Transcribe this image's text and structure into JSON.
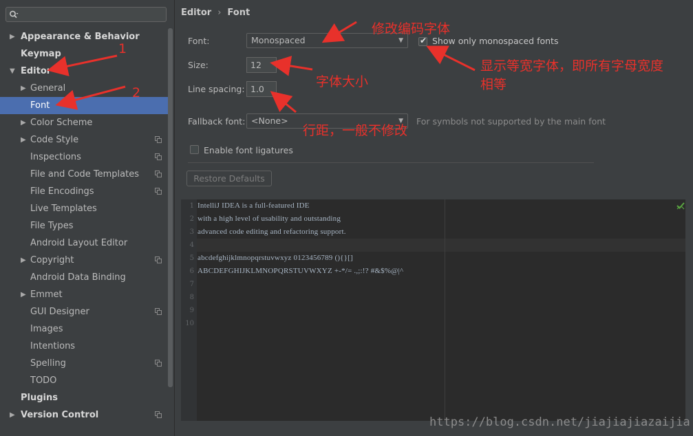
{
  "search": {
    "placeholder": ""
  },
  "sidebar": {
    "items": [
      {
        "label": "Appearance & Behavior",
        "level": 0,
        "expandable": true,
        "expanded": false,
        "bold": true,
        "project": false,
        "selected": false
      },
      {
        "label": "Keymap",
        "level": 0,
        "expandable": false,
        "expanded": false,
        "bold": true,
        "project": false,
        "selected": false
      },
      {
        "label": "Editor",
        "level": 0,
        "expandable": true,
        "expanded": true,
        "bold": true,
        "project": false,
        "selected": false
      },
      {
        "label": "General",
        "level": 1,
        "expandable": true,
        "expanded": false,
        "bold": false,
        "project": false,
        "selected": false
      },
      {
        "label": "Font",
        "level": 1,
        "expandable": false,
        "expanded": false,
        "bold": false,
        "project": false,
        "selected": true
      },
      {
        "label": "Color Scheme",
        "level": 1,
        "expandable": true,
        "expanded": false,
        "bold": false,
        "project": false,
        "selected": false
      },
      {
        "label": "Code Style",
        "level": 1,
        "expandable": true,
        "expanded": false,
        "bold": false,
        "project": true,
        "selected": false
      },
      {
        "label": "Inspections",
        "level": 1,
        "expandable": false,
        "expanded": false,
        "bold": false,
        "project": true,
        "selected": false
      },
      {
        "label": "File and Code Templates",
        "level": 1,
        "expandable": false,
        "expanded": false,
        "bold": false,
        "project": true,
        "selected": false
      },
      {
        "label": "File Encodings",
        "level": 1,
        "expandable": false,
        "expanded": false,
        "bold": false,
        "project": true,
        "selected": false
      },
      {
        "label": "Live Templates",
        "level": 1,
        "expandable": false,
        "expanded": false,
        "bold": false,
        "project": false,
        "selected": false
      },
      {
        "label": "File Types",
        "level": 1,
        "expandable": false,
        "expanded": false,
        "bold": false,
        "project": false,
        "selected": false
      },
      {
        "label": "Android Layout Editor",
        "level": 1,
        "expandable": false,
        "expanded": false,
        "bold": false,
        "project": false,
        "selected": false
      },
      {
        "label": "Copyright",
        "level": 1,
        "expandable": true,
        "expanded": false,
        "bold": false,
        "project": true,
        "selected": false
      },
      {
        "label": "Android Data Binding",
        "level": 1,
        "expandable": false,
        "expanded": false,
        "bold": false,
        "project": false,
        "selected": false
      },
      {
        "label": "Emmet",
        "level": 1,
        "expandable": true,
        "expanded": false,
        "bold": false,
        "project": false,
        "selected": false
      },
      {
        "label": "GUI Designer",
        "level": 1,
        "expandable": false,
        "expanded": false,
        "bold": false,
        "project": true,
        "selected": false
      },
      {
        "label": "Images",
        "level": 1,
        "expandable": false,
        "expanded": false,
        "bold": false,
        "project": false,
        "selected": false
      },
      {
        "label": "Intentions",
        "level": 1,
        "expandable": false,
        "expanded": false,
        "bold": false,
        "project": false,
        "selected": false
      },
      {
        "label": "Spelling",
        "level": 1,
        "expandable": false,
        "expanded": false,
        "bold": false,
        "project": true,
        "selected": false
      },
      {
        "label": "TODO",
        "level": 1,
        "expandable": false,
        "expanded": false,
        "bold": false,
        "project": false,
        "selected": false
      },
      {
        "label": "Plugins",
        "level": 0,
        "expandable": false,
        "expanded": false,
        "bold": true,
        "project": false,
        "selected": false
      },
      {
        "label": "Version Control",
        "level": 0,
        "expandable": true,
        "expanded": false,
        "bold": true,
        "project": true,
        "selected": false
      }
    ]
  },
  "breadcrumb": {
    "parent": "Editor",
    "separator": "›",
    "current": "Font"
  },
  "form": {
    "font_label": "Font:",
    "font_value": "Monospaced",
    "mono_only_label": "Show only monospaced fonts",
    "mono_only_checked": true,
    "size_label": "Size:",
    "size_value": "12",
    "line_spacing_label": "Line spacing:",
    "line_spacing_value": "1.0",
    "fallback_label": "Fallback font:",
    "fallback_value": "<None>",
    "fallback_hint": "For symbols not supported by the main font",
    "ligatures_label": "Enable font ligatures",
    "ligatures_checked": false,
    "restore_label": "Restore Defaults"
  },
  "preview": {
    "line_numbers": [
      "1",
      "2",
      "3",
      "4",
      "5",
      "6",
      "7",
      "8",
      "9",
      "10"
    ],
    "lines": [
      "IntelliJ IDEA is a full-featured IDE",
      "with a high level of usability and outstanding",
      "advanced code editing and refactoring support.",
      "",
      "abcdefghijklmnopqrstuvwxyz 0123456789 (){}[]",
      "ABCDEFGHIJKLMNOPQRSTUVWXYZ +-*/= .,;:!? #&$%@|^",
      "",
      "",
      "",
      ""
    ]
  },
  "annotations": {
    "editor_number": "1",
    "font_number": "2",
    "change_font": "修改编码字体",
    "mono_explain_line1": "显示等宽字体，即所有字母宽度",
    "mono_explain_line2": "相等",
    "font_size": "字体大小",
    "line_spacing": "行距，一般不修改"
  },
  "watermark": "https://blog.csdn.net/jiajiajiazaijia",
  "colors": {
    "background": "#3c3f41",
    "selection": "#4b6eaf",
    "annotation_red": "#e8312b",
    "editor_bg": "#2b2b2b"
  }
}
